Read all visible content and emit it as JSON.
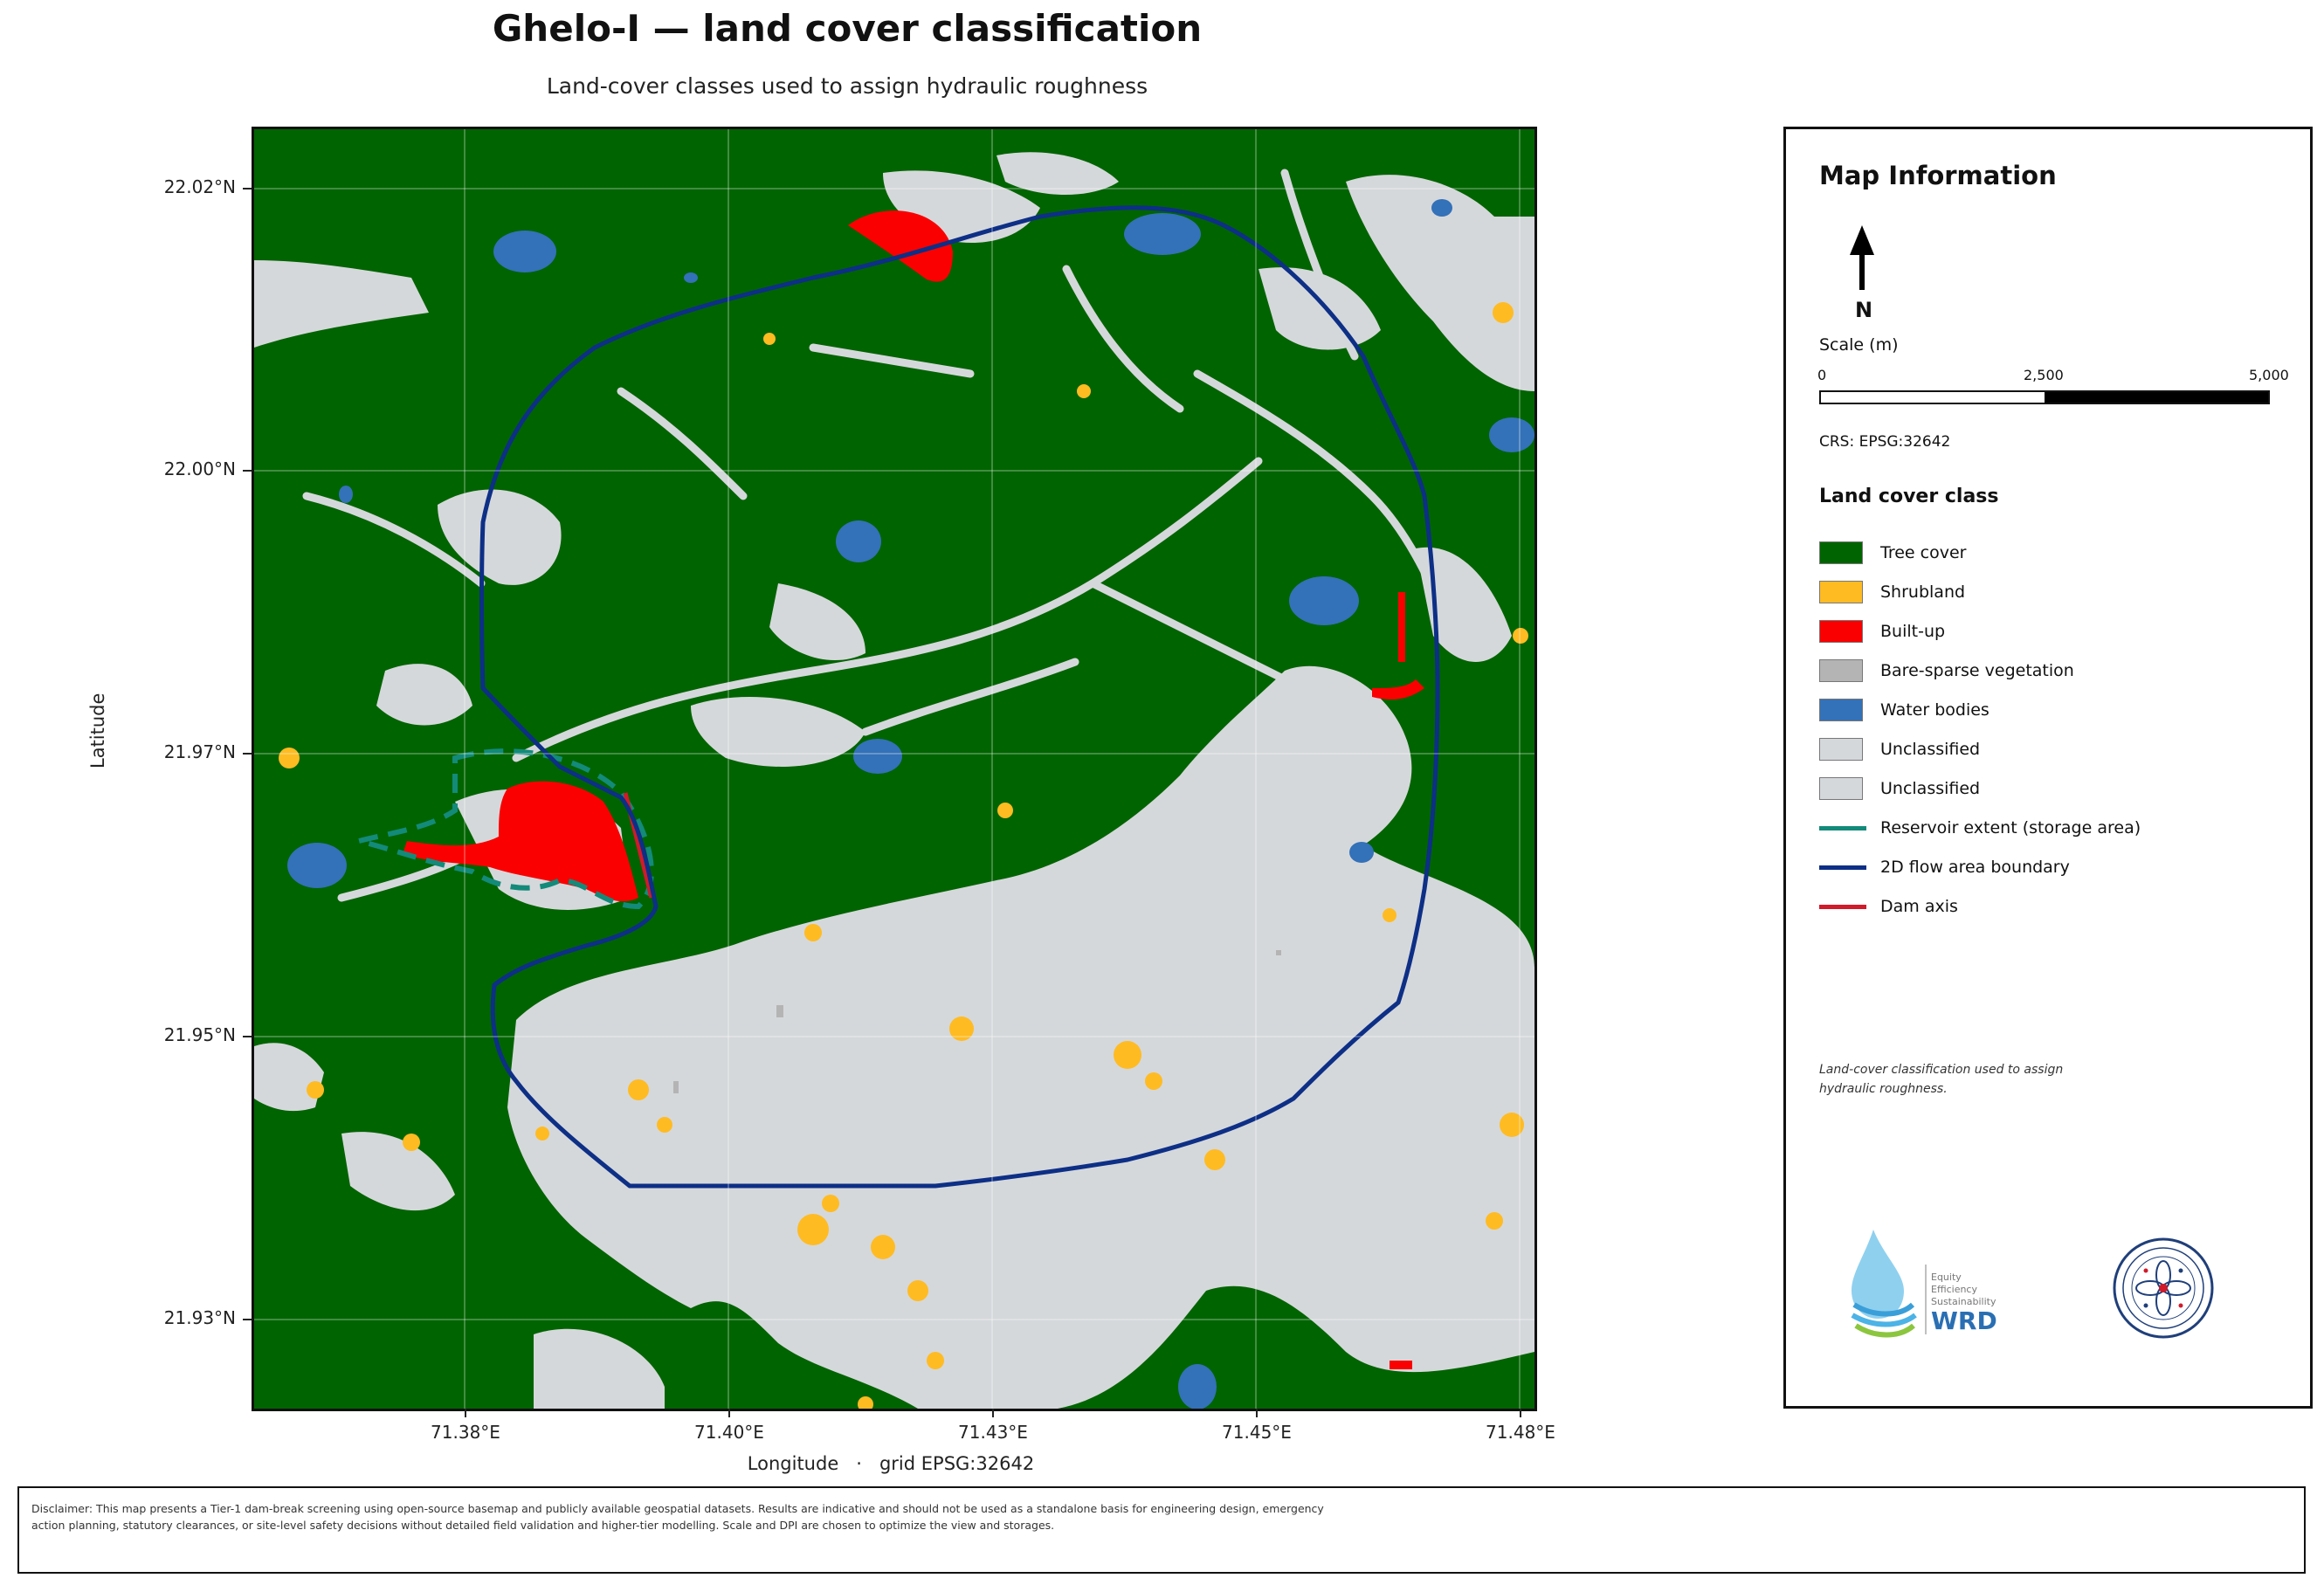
{
  "title": "Ghelo-I — land cover classification",
  "subtitle": "Land-cover classes used to assign hydraulic roughness",
  "map": {
    "y_axis_label": "Latitude",
    "x_axis_label": "Longitude   ·   grid EPSG:32642",
    "y_ticks": [
      "22.02°N",
      "22.00°N",
      "21.97°N",
      "21.95°N",
      "21.93°N"
    ],
    "x_ticks": [
      "71.38°E",
      "71.40°E",
      "71.43°E",
      "71.45°E",
      "71.48°E"
    ],
    "colors": {
      "tree_cover": "#006400",
      "shrubland": "#ffbb22",
      "built_up": "#fa0000",
      "bare": "#b4b4b4",
      "water": "#3371b8",
      "unclassified": "#d5d8db",
      "reservoir": "#138a7a",
      "flow_boundary": "#0d2f86",
      "dam_axis": "#d11a2a"
    }
  },
  "panel": {
    "title": "Map Information",
    "north_label": "N",
    "scale_label": "Scale (m)",
    "scale_ticks": [
      "0",
      "2,500",
      "5,000"
    ],
    "crs": "CRS: EPSG:32642",
    "legend_title": "Land cover class",
    "legend_items": [
      {
        "label": "Tree cover",
        "kind": "fill",
        "color": "#006400"
      },
      {
        "label": "Shrubland",
        "kind": "fill",
        "color": "#ffbb22"
      },
      {
        "label": "Built-up",
        "kind": "fill",
        "color": "#fa0000"
      },
      {
        "label": "Bare-sparse vegetation",
        "kind": "fill",
        "color": "#b4b4b4"
      },
      {
        "label": "Water bodies",
        "kind": "fill",
        "color": "#3371b8"
      },
      {
        "label": "Unclassified",
        "kind": "fill",
        "color": "#d5d8db"
      },
      {
        "label": "Unclassified",
        "kind": "fill",
        "color": "#d5d8db"
      },
      {
        "label": "Reservoir extent (storage area)",
        "kind": "line",
        "color": "#138a7a"
      },
      {
        "label": "2D flow area boundary",
        "kind": "line",
        "color": "#0d2f86"
      },
      {
        "label": "Dam axis",
        "kind": "line",
        "color": "#d11a2a"
      }
    ],
    "note": "Land-cover classification used to assign hydraulic roughness.",
    "logo_text": {
      "line1": "Equity",
      "line2": "Efficiency",
      "line3": "Sustainability",
      "brand": "WRD"
    }
  },
  "disclaimer": "Disclaimer: This map presents a Tier-1 dam-break screening using open-source basemap and publicly available geospatial datasets. Results are indicative and should not be used as a standalone basis for engineering design, emergency action planning, statutory clearances, or site-level safety decisions without detailed field validation and higher-tier modelling. Scale and DPI are chosen to optimize the view and storages."
}
